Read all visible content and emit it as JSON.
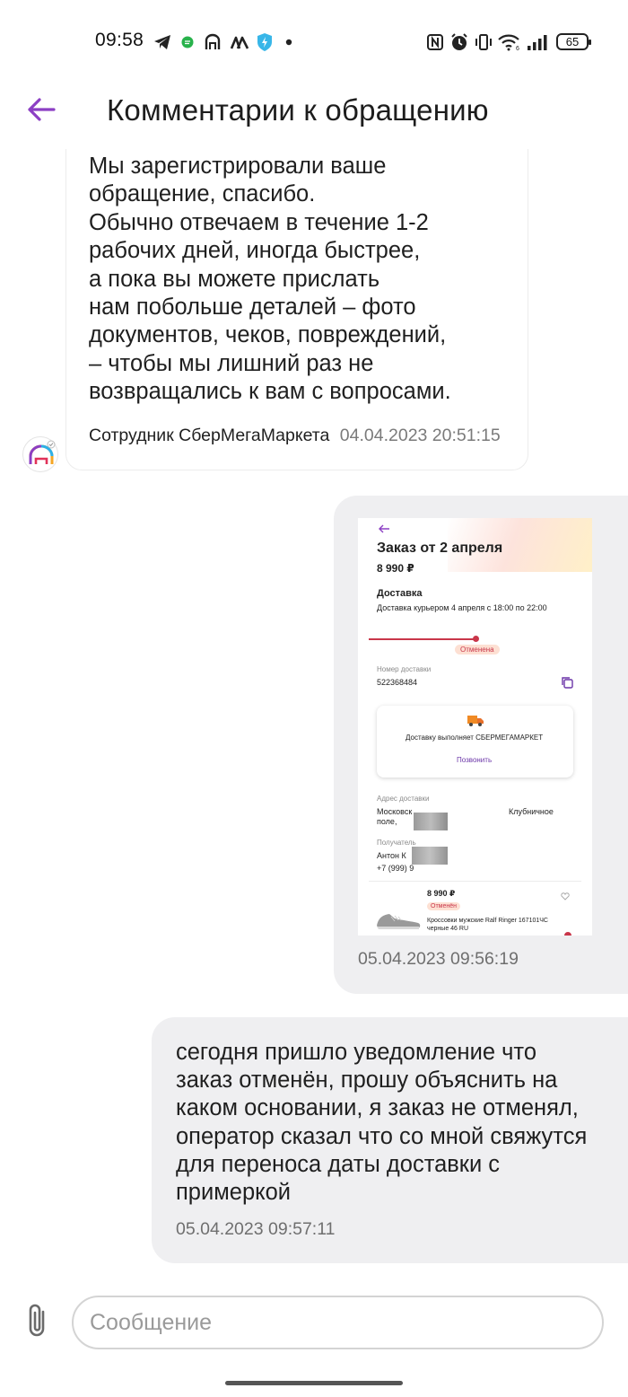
{
  "status_bar": {
    "time": "09:58",
    "battery_level": "65",
    "left_icons": [
      "telegram-icon",
      "messenger-icon",
      "megamarket-icon",
      "notes-icon",
      "vpn-shield-icon",
      "dot-icon"
    ],
    "right_icons": [
      "nfc-icon",
      "alarm-icon",
      "vibrate-icon",
      "wifi-icon",
      "signal-icon",
      "battery-icon"
    ]
  },
  "header": {
    "title": "Комментарии к обращению",
    "back_icon": "arrow-left-icon",
    "accent_color": "#8c3fc4"
  },
  "messages": [
    {
      "direction": "incoming",
      "text": "Мы зарегистрировали ваше\nобращение, спасибо.\nОбычно отвечаем в течение 1-2\nрабочих дней, иногда быстрее,\nа пока вы можете прислать\nнам побольше деталей – фото\nдокументов, чеков, повреждений,\n– чтобы мы лишний раз не\nвозвращались к вам с вопросами.",
      "sender": "Сотрудник СберМегаМаркета",
      "timestamp": "04.04.2023 20:51:15"
    },
    {
      "direction": "outgoing",
      "type": "image",
      "timestamp": "05.04.2023 09:56:19",
      "attachment": {
        "title": "Заказ от 2 апреля",
        "price": "8 990 ₽",
        "delivery_heading": "Доставка",
        "delivery_text": "Доставка курьером 4 апреля с 18:00 по 22:00",
        "status_badge": "Отменена",
        "tracking_label": "Номер доставки",
        "tracking_number": "522368484",
        "carrier_text": "Доставку выполняет",
        "carrier_name": "СБЕРМЕГАМАРКЕТ",
        "call_link": "Позвонить",
        "address_label": "Адрес доставки",
        "address_line1_start": "Московск",
        "address_line1_end": "Клубничное",
        "address_line2": "поле,",
        "recipient_label": "Получатель",
        "recipient_name": "Антон К",
        "recipient_phone": "+7 (999) 9",
        "item_price": "8 990 ₽",
        "item_status": "Отменён",
        "item_name_line1": "Кроссовки мужские Ralf Ringer 167101ЧС",
        "item_name_line2": "черные 46 RU"
      }
    },
    {
      "direction": "outgoing",
      "text": "сегодня пришло уведомление что заказ отменён, прошу объяснить на каком основании, я заказ не отменял, оператор сказал что со мной свяжутся для переноса даты доставки с примеркой",
      "timestamp": "05.04.2023 09:57:11"
    }
  ],
  "composer": {
    "placeholder": "Сообщение",
    "value": "",
    "attach_icon": "paperclip-icon"
  }
}
